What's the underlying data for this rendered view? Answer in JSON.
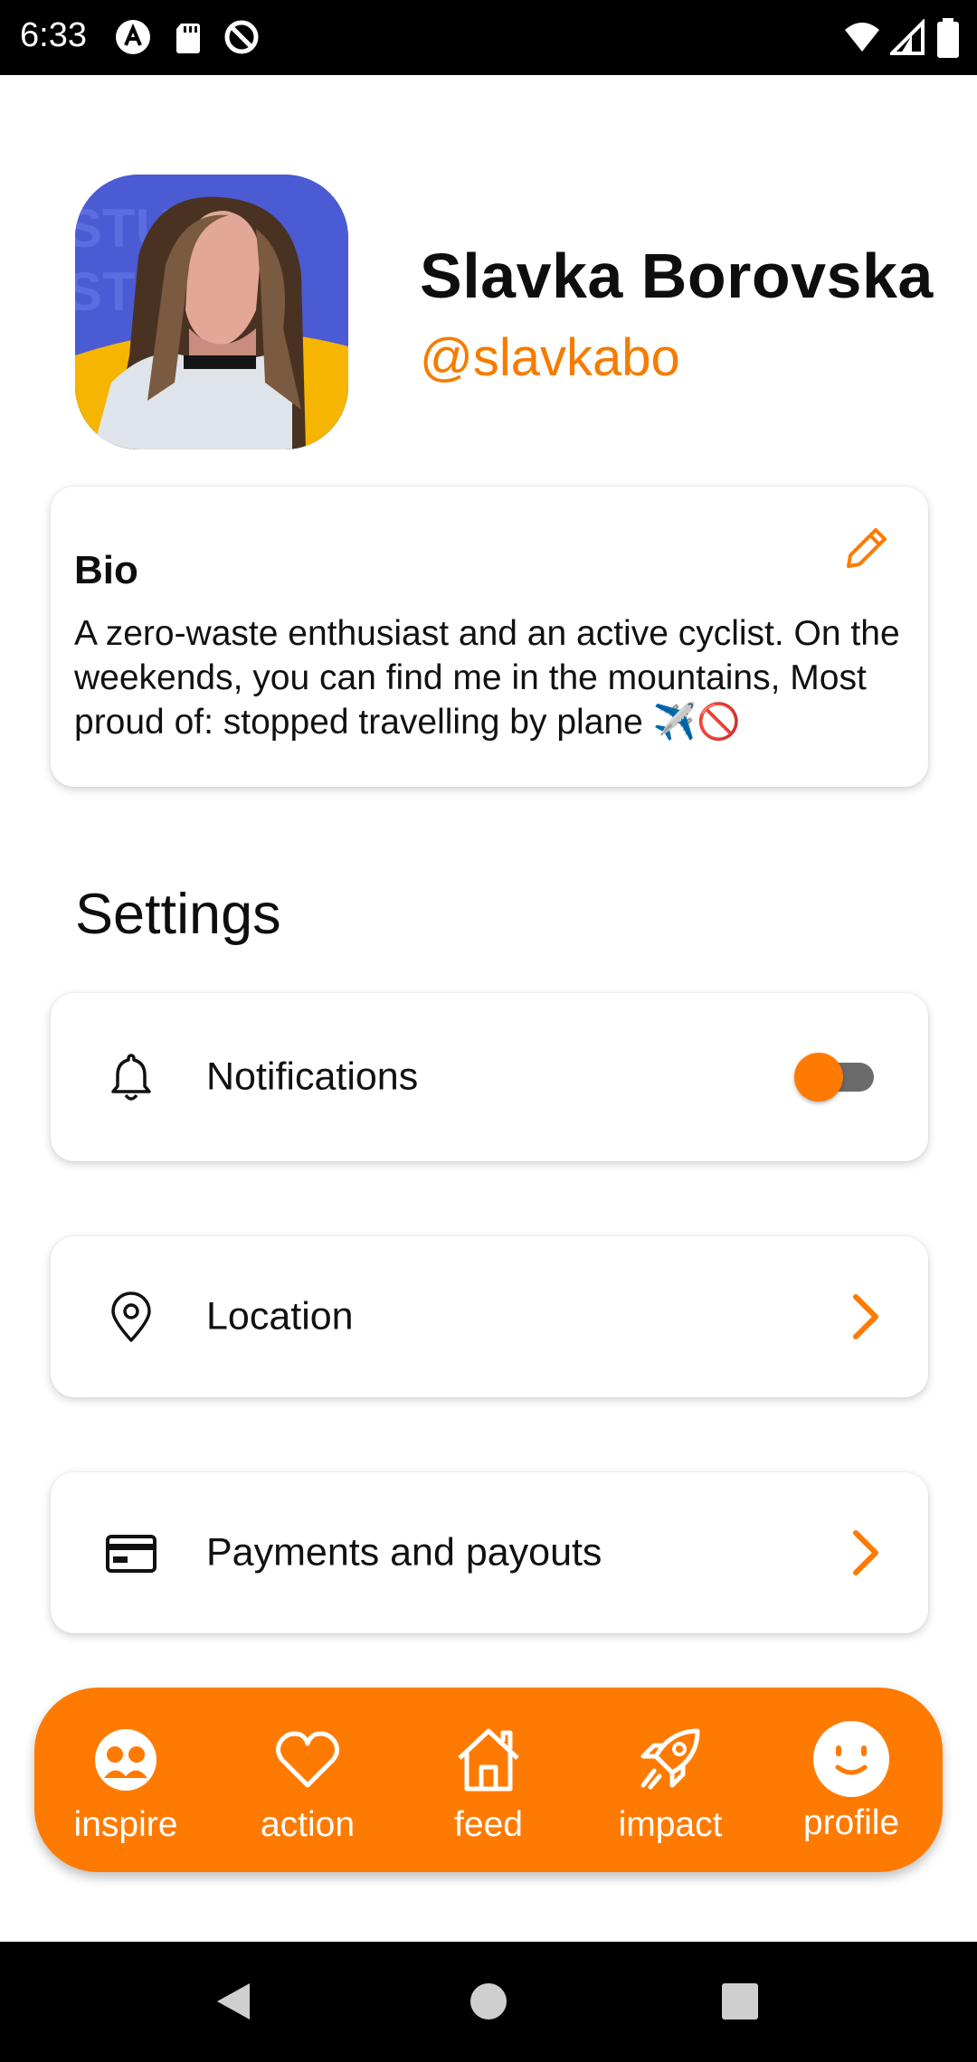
{
  "status_bar": {
    "time": "6:33",
    "icons": [
      "a-notification-icon",
      "sd-card-icon",
      "data-saver-icon",
      "wifi-icon",
      "signal-icon",
      "battery-icon"
    ]
  },
  "profile": {
    "name": "Slavka Borovska",
    "handle": "@slavkabo"
  },
  "bio": {
    "title": "Bio",
    "text": "A zero-waste enthusiast and an active cyclist. On the weekends, you can find me in the mountains, Most proud of: stopped travelling by plane ✈️🚫",
    "edit_icon": "pencil-icon"
  },
  "settings": {
    "title": "Settings",
    "items": [
      {
        "label": "Notifications",
        "icon": "bell-icon",
        "control": "toggle",
        "enabled": true
      },
      {
        "label": "Location",
        "icon": "location-pin-icon",
        "control": "chevron"
      },
      {
        "label": "Payments and payouts",
        "icon": "credit-card-icon",
        "control": "chevron"
      }
    ]
  },
  "bottom_nav": {
    "items": [
      {
        "label": "inspire",
        "icon": "inspire-faces-icon"
      },
      {
        "label": "action",
        "icon": "heart-icon"
      },
      {
        "label": "feed",
        "icon": "home-icon"
      },
      {
        "label": "impact",
        "icon": "rocket-icon"
      },
      {
        "label": "profile",
        "icon": "smiley-icon",
        "active": true
      }
    ]
  },
  "colors": {
    "accent": "#ff7a00",
    "handle": "#f57c00",
    "toggle_track": "#6b6b6b",
    "avatar_bg": "#4a5bd4"
  }
}
